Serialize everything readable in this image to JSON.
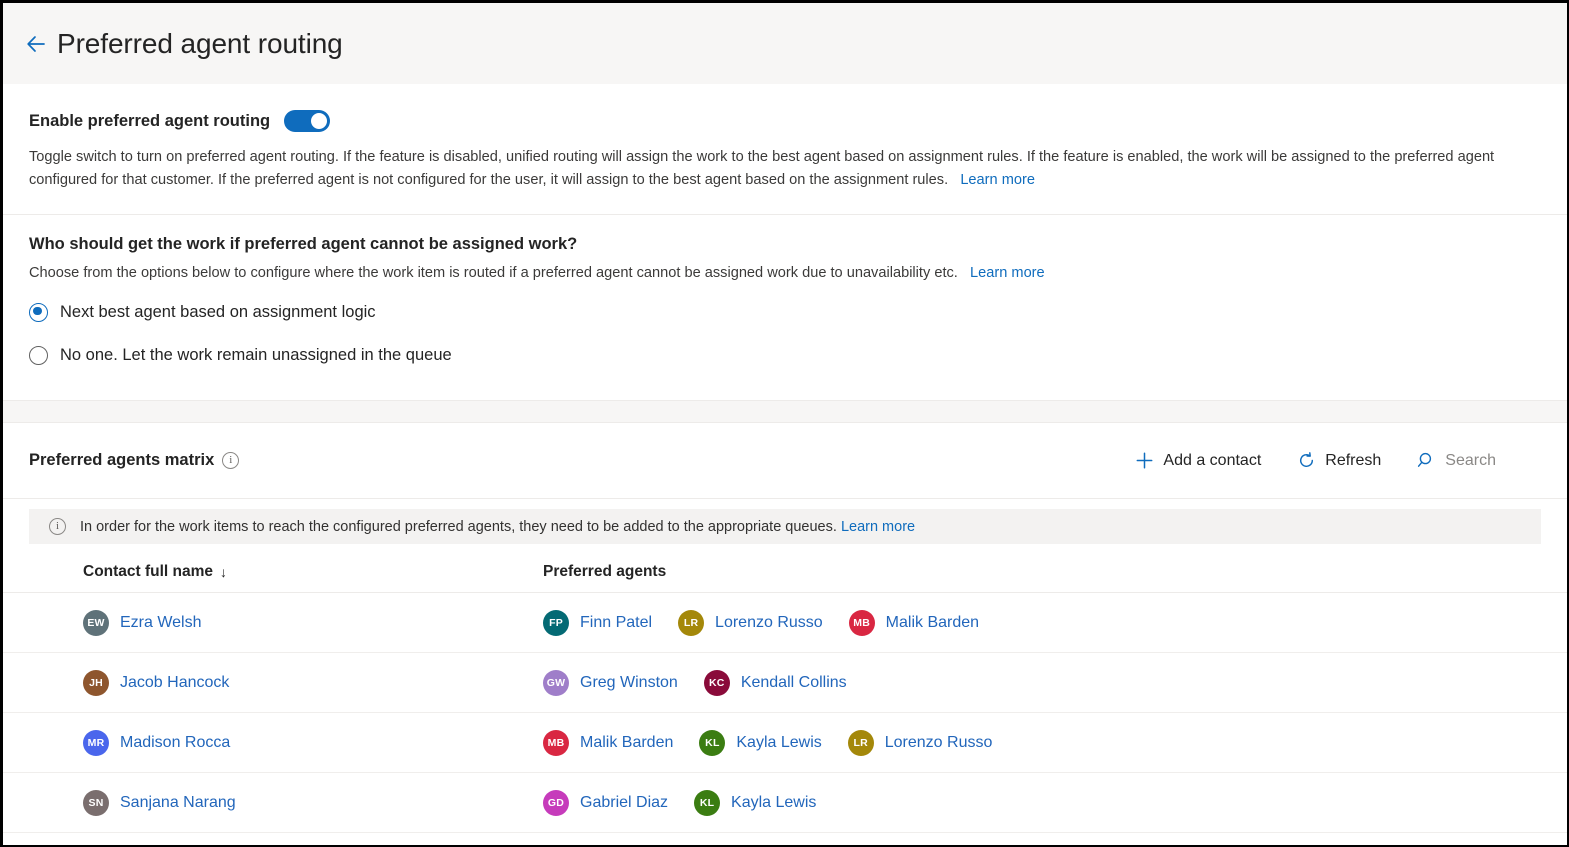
{
  "header": {
    "back_icon": "arrow-left-icon",
    "title": "Preferred agent routing"
  },
  "enable_section": {
    "label": "Enable preferred agent routing",
    "toggle_on": true,
    "description": "Toggle switch to turn on preferred agent routing. If the feature is disabled, unified routing will assign the work to the best agent based on assignment rules. If the feature is enabled, the work will be assigned to the preferred agent configured for that customer. If the preferred agent is not configured for the user, it will assign to the best agent based on the assignment rules.",
    "learn_more": "Learn more"
  },
  "fallback_section": {
    "title": "Who should get the work if preferred agent cannot be assigned work?",
    "subtitle": "Choose from the options below to configure where the work item is routed if a preferred agent cannot be assigned work due to unavailability etc.",
    "learn_more": "Learn more",
    "options": [
      {
        "label": "Next best agent based on assignment logic",
        "selected": true
      },
      {
        "label": "No one. Let the work remain unassigned in the queue",
        "selected": false
      }
    ]
  },
  "matrix": {
    "title": "Preferred agents matrix",
    "info_icon": "info-icon",
    "commands": [
      {
        "label": "Add a contact",
        "icon": "plus-icon"
      },
      {
        "label": "Refresh",
        "icon": "refresh-icon"
      }
    ],
    "search": {
      "label": "Search",
      "icon": "search-icon"
    },
    "banner": {
      "icon": "info-icon",
      "text": "In order for the work items to reach the configured preferred agents, they need to be added to the appropriate queues.",
      "learn_more": "Learn more"
    },
    "columns": [
      {
        "label": "Contact full name",
        "sort": "↓"
      },
      {
        "label": "Preferred agents",
        "sort": ""
      }
    ],
    "rows": [
      {
        "contact": {
          "initials": "EW",
          "name": "Ezra Welsh",
          "color": "#5f7279"
        },
        "agents": [
          {
            "initials": "FP",
            "name": "Finn Patel",
            "color": "#046a74"
          },
          {
            "initials": "LR",
            "name": "Lorenzo Russo",
            "color": "#a4880a"
          },
          {
            "initials": "MB",
            "name": "Malik Barden",
            "color": "#d92742"
          }
        ]
      },
      {
        "contact": {
          "initials": "JH",
          "name": "Jacob Hancock",
          "color": "#8e562e"
        },
        "agents": [
          {
            "initials": "GW",
            "name": "Greg Winston",
            "color": "#9f7ec9"
          },
          {
            "initials": "KC",
            "name": "Kendall Collins",
            "color": "#8a0b3a"
          }
        ]
      },
      {
        "contact": {
          "initials": "MR",
          "name": "Madison Rocca",
          "color": "#4a66ec"
        },
        "agents": [
          {
            "initials": "MB",
            "name": "Malik Barden",
            "color": "#d92742"
          },
          {
            "initials": "KL",
            "name": "Kayla Lewis",
            "color": "#3b7d12"
          },
          {
            "initials": "LR",
            "name": "Lorenzo Russo",
            "color": "#a4880a"
          }
        ]
      },
      {
        "contact": {
          "initials": "SN",
          "name": "Sanjana Narang",
          "color": "#7a6e6e"
        },
        "agents": [
          {
            "initials": "GD",
            "name": "Gabriel Diaz",
            "color": "#c63bbb"
          },
          {
            "initials": "KL",
            "name": "Kayla Lewis",
            "color": "#3b7d12"
          }
        ]
      }
    ]
  },
  "theme": {
    "accent": "#0f6cbd",
    "link": "#2266bb",
    "header_bg": "#f7f6f5",
    "banner_bg": "#f3f2f1"
  }
}
